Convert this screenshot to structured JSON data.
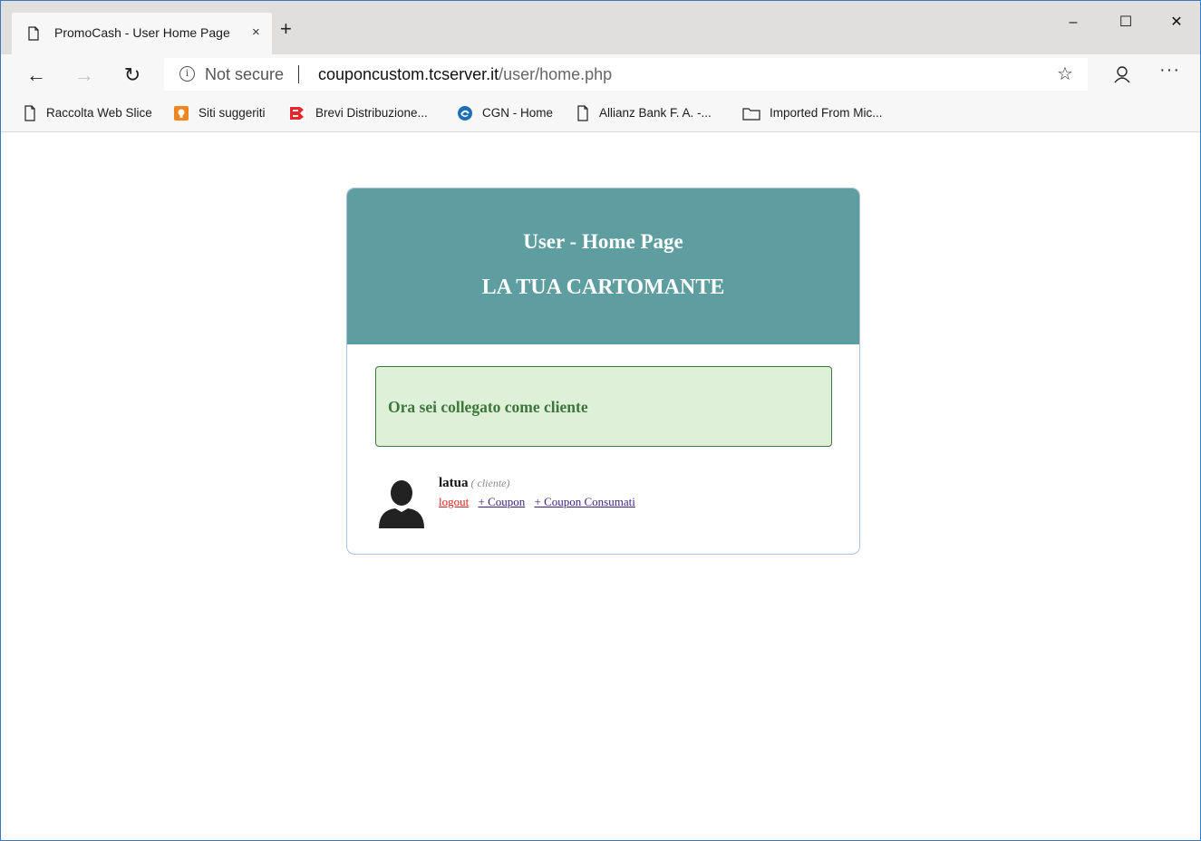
{
  "browser": {
    "tab_title": "PromoCash - User Home Page",
    "tab_close": "×",
    "new_tab": "+",
    "window_controls": {
      "minimize": "–",
      "maximize": "☐",
      "close": "✕"
    },
    "nav": {
      "back": "←",
      "forward": "→",
      "refresh": "↻",
      "more": "···"
    },
    "address": {
      "security": "Not secure",
      "host": "couponcustom.tcserver.it",
      "path": "/user/home.php"
    },
    "favorites": [
      {
        "label": "Raccolta Web Slice",
        "icon": "page-icon"
      },
      {
        "label": "Siti suggeriti",
        "icon": "suggested-sites-icon"
      },
      {
        "label": "Brevi Distribuzione...",
        "icon": "brevi-logo-icon"
      },
      {
        "label": "CGN - Home",
        "icon": "cgn-logo-icon"
      },
      {
        "label": "Allianz Bank F. A. -...",
        "icon": "page-icon"
      },
      {
        "label": "Imported From Mic...",
        "icon": "folder-icon"
      }
    ]
  },
  "page": {
    "header_title": "User - Home Page",
    "header_subtitle": "LA TUA CARTOMANTE",
    "alert_text": "Ora sei collegato come cliente",
    "username": "latua",
    "role": "( cliente)",
    "links": {
      "logout": "logout",
      "coupon": "+ Coupon",
      "coupon_used": "+ Coupon Consumati"
    }
  },
  "colors": {
    "header_bg": "#5f9ea0",
    "alert_bg": "#dff0d8",
    "alert_text": "#3c763d",
    "logout_link": "#e0201e"
  }
}
